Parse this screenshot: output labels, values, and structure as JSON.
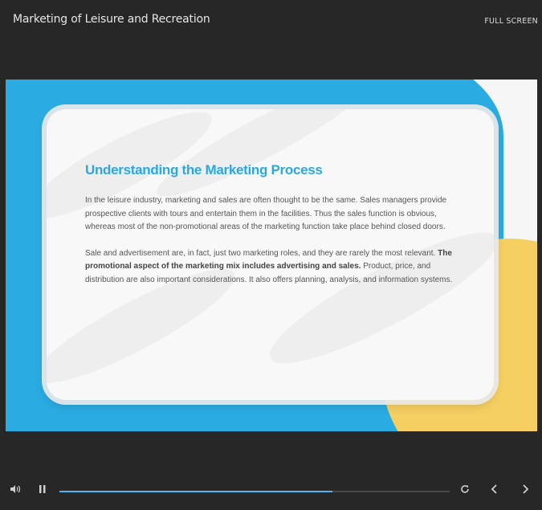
{
  "header": {
    "title": "Marketing of Leisure and Recreation",
    "fullscreen_label": "FULL SCREEN"
  },
  "slide": {
    "heading": "Understanding the Marketing Process",
    "paragraph1": "In the leisure industry, marketing and sales are often thought to be the same. Sales managers provide prospective clients with tours and entertain them in the facilities. Thus the sales function is obvious, whereas most of the non-promotional areas of the marketing function take place behind closed doors.",
    "paragraph2_start": "Sale and advertisement are, in fact, just two marketing roles, and they are rarely the most relevant.",
    "paragraph2_bold": " The promotional aspect of the marketing mix includes advertising and sales.",
    "paragraph2_end": " Product, price, and distribution are also important considerations. It also offers planning, analysis, and information systems.",
    "colors": {
      "accent_blue": "#2aabe2",
      "accent_yellow": "#f5cf62"
    }
  },
  "player": {
    "progress": 0.7,
    "icons": [
      "volume-icon",
      "pause-icon",
      "replay-icon",
      "previous-icon",
      "next-icon"
    ]
  }
}
